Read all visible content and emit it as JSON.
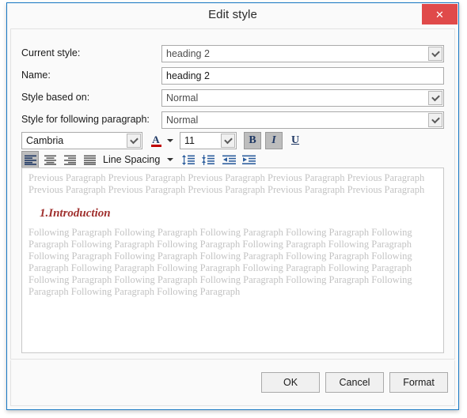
{
  "window": {
    "title": "Edit style",
    "close_label": "✕",
    "accent_border": "#1778c4",
    "close_bg": "#e04a4a"
  },
  "fields": [
    {
      "label": "Current style:",
      "value": "heading 2",
      "type": "combobox",
      "has_arrow": true
    },
    {
      "label": "Name:",
      "value": "heading 2",
      "type": "textbox",
      "has_arrow": false
    },
    {
      "label": "Style based on:",
      "value": "Normal",
      "type": "combobox",
      "has_arrow": true
    },
    {
      "label": "Style for following paragraph:",
      "value": "Normal",
      "type": "combobox",
      "has_arrow": true
    }
  ],
  "toolbar": {
    "font_family": "Cambria",
    "font_size": "11",
    "font_color_letter": "A",
    "font_color_swatch": "#c00000",
    "bold_label": "B",
    "italic_label": "I",
    "underline_label": "U",
    "bold_pressed": true,
    "italic_pressed": true,
    "underline_pressed": false,
    "line_spacing_label": "Line Spacing",
    "align_left_pressed": true,
    "icons": [
      "align-left-icon",
      "align-center-icon",
      "align-right-icon",
      "align-justify-icon",
      "line-spacing-increase-icon",
      "line-spacing-decrease-icon",
      "decrease-indent-icon",
      "increase-indent-icon"
    ]
  },
  "preview": {
    "previous_paragraph": "Previous Paragraph Previous Paragraph Previous Paragraph Previous Paragraph Previous Paragraph Previous Paragraph Previous Paragraph Previous Paragraph Previous Paragraph Previous Paragraph",
    "sample_heading": "1.Introduction",
    "sample_heading_color": "#a0302e",
    "following_paragraph": "Following Paragraph Following Paragraph Following Paragraph Following Paragraph Following Paragraph Following Paragraph Following Paragraph Following Paragraph Following Paragraph Following Paragraph Following Paragraph Following Paragraph Following Paragraph Following Paragraph Following Paragraph Following Paragraph Following Paragraph Following Paragraph Following Paragraph Following Paragraph Following Paragraph Following Paragraph Following Paragraph Following Paragraph Following Paragraph"
  },
  "footer": {
    "ok_label": "OK",
    "cancel_label": "Cancel",
    "format_label": "Format"
  }
}
